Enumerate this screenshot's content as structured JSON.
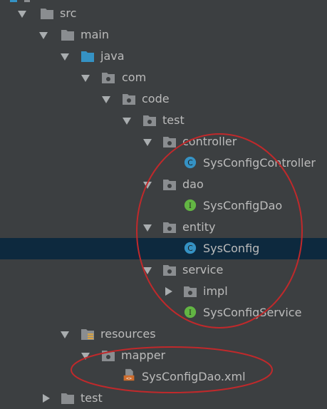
{
  "tree": {
    "items": [
      {
        "label": "src",
        "type": "folder",
        "expanded": true
      },
      {
        "label": "main",
        "type": "folder",
        "expanded": true
      },
      {
        "label": "java",
        "type": "source-folder",
        "expanded": true
      },
      {
        "label": "com",
        "type": "package",
        "expanded": true
      },
      {
        "label": "code",
        "type": "package",
        "expanded": true
      },
      {
        "label": "test",
        "type": "package",
        "expanded": true
      },
      {
        "label": "controller",
        "type": "package",
        "expanded": true
      },
      {
        "label": "SysConfigController",
        "type": "class",
        "badge": "C"
      },
      {
        "label": "dao",
        "type": "package",
        "expanded": true
      },
      {
        "label": "SysConfigDao",
        "type": "interface",
        "badge": "I"
      },
      {
        "label": "entity",
        "type": "package",
        "expanded": true
      },
      {
        "label": "SysConfig",
        "type": "class",
        "badge": "C",
        "selected": true
      },
      {
        "label": "service",
        "type": "package",
        "expanded": true
      },
      {
        "label": "impl",
        "type": "package",
        "expanded": false
      },
      {
        "label": "SysConfigService",
        "type": "interface",
        "badge": "I"
      },
      {
        "label": "resources",
        "type": "resources-folder",
        "expanded": true
      },
      {
        "label": "mapper",
        "type": "package",
        "expanded": true
      },
      {
        "label": "SysConfigDao.xml",
        "type": "xml-file"
      },
      {
        "label": "test",
        "type": "folder",
        "expanded": false
      }
    ]
  },
  "colors": {
    "background": "#3c3f41",
    "selection": "#0d293e",
    "text": "#bbbbbb",
    "annotation": "#c0292b",
    "class_badge": "#3592c4",
    "interface_badge": "#62b543",
    "folder": "#8a8d90",
    "source_folder": "#3592c4"
  }
}
